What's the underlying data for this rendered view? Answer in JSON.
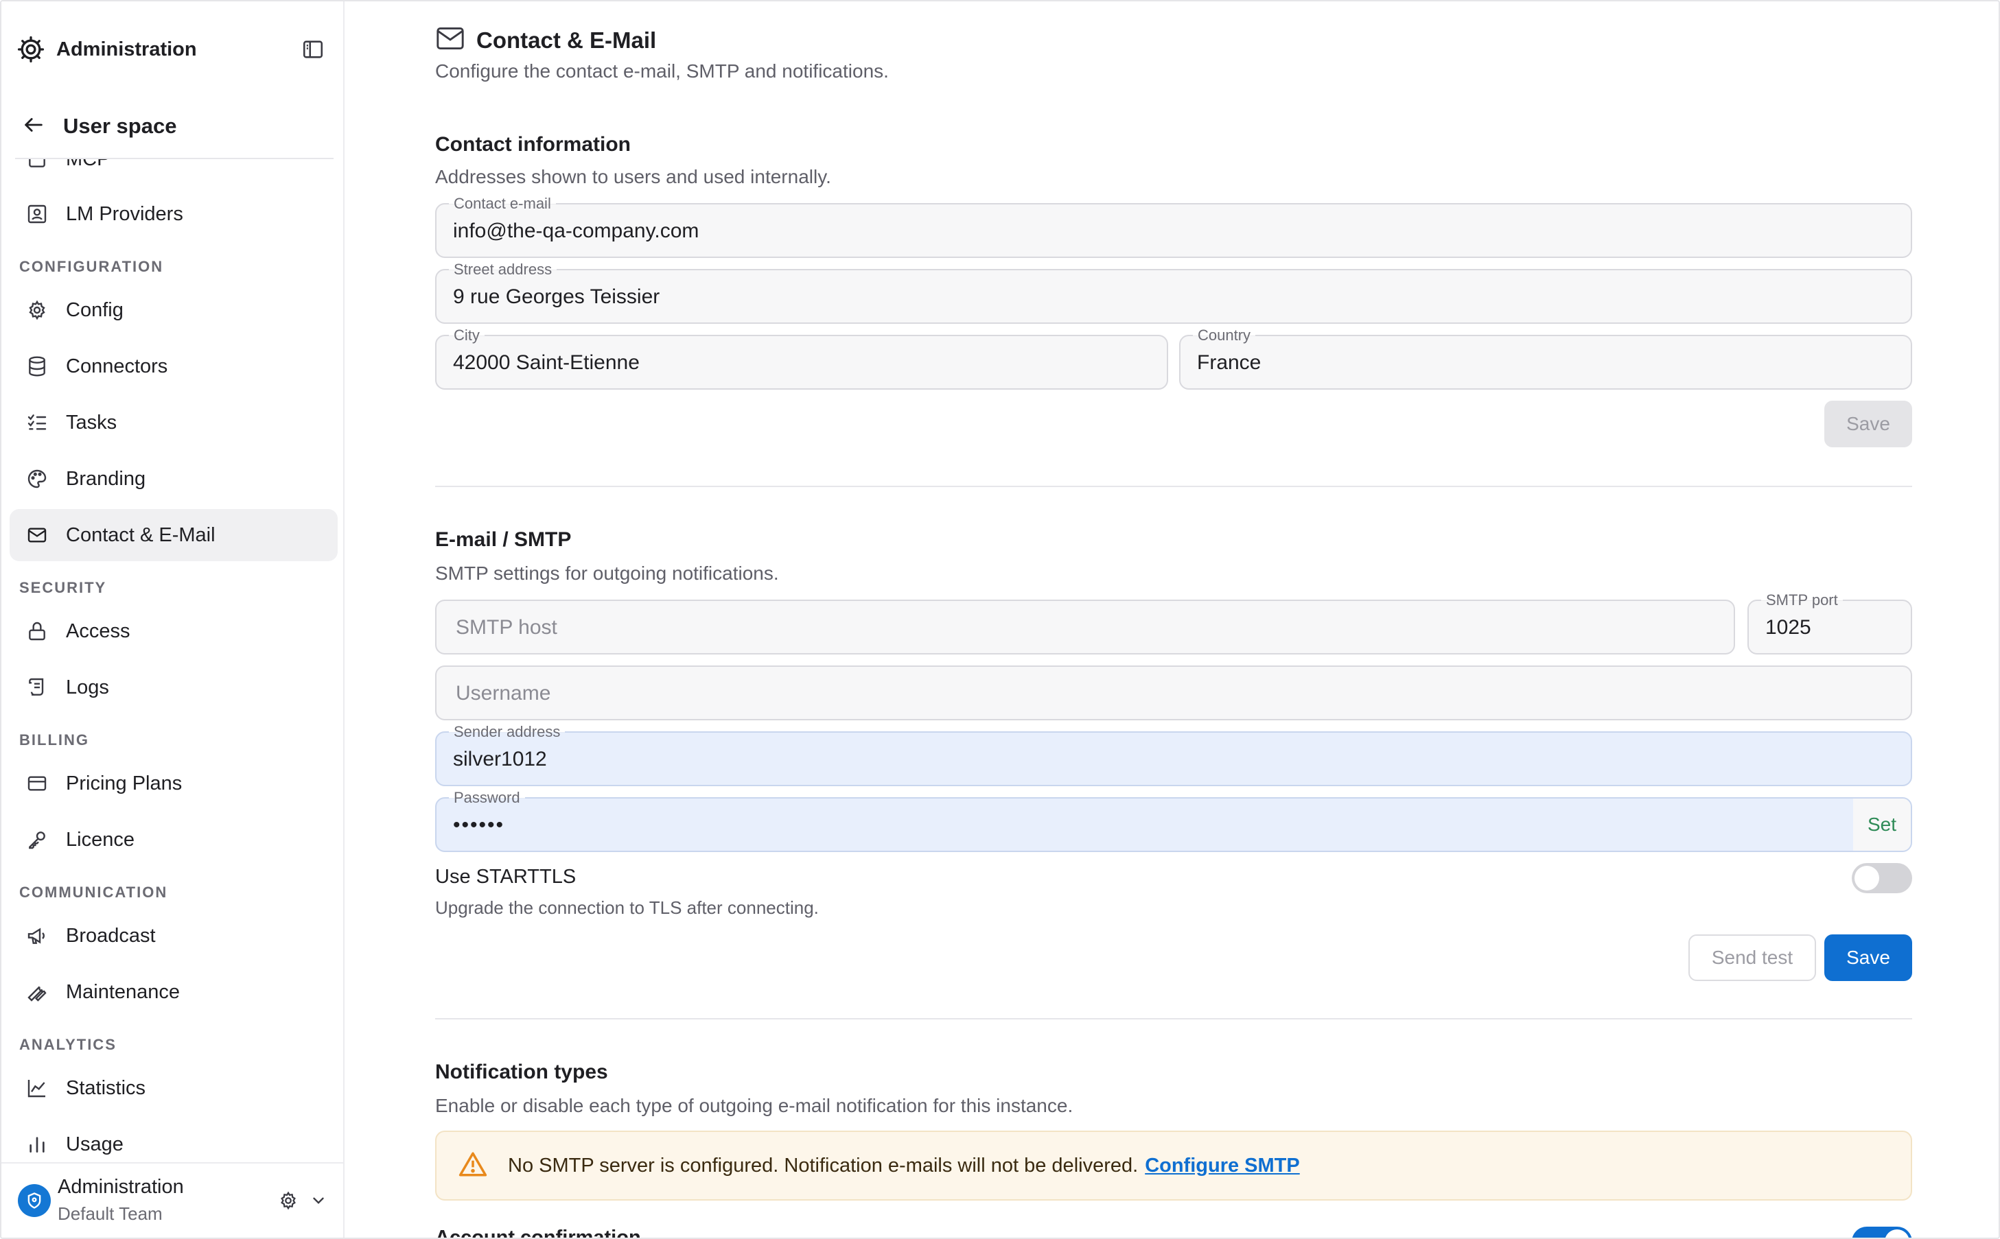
{
  "sidebar": {
    "title": "Administration",
    "back_label": "User space",
    "cut_item": "MCP",
    "items": [
      {
        "label": "LM Providers",
        "icon": "lm-providers-icon"
      },
      {
        "label": "Config",
        "icon": "gear-icon"
      },
      {
        "label": "Connectors",
        "icon": "database-icon"
      },
      {
        "label": "Tasks",
        "icon": "checklist-icon"
      },
      {
        "label": "Branding",
        "icon": "palette-icon"
      },
      {
        "label": "Contact & E-Mail",
        "icon": "mail-icon",
        "active": true
      },
      {
        "label": "Access",
        "icon": "lock-icon"
      },
      {
        "label": "Logs",
        "icon": "scroll-icon"
      },
      {
        "label": "Pricing Plans",
        "icon": "credit-card-icon"
      },
      {
        "label": "Licence",
        "icon": "key-icon"
      },
      {
        "label": "Broadcast",
        "icon": "megaphone-icon"
      },
      {
        "label": "Maintenance",
        "icon": "wrench-icon"
      },
      {
        "label": "Statistics",
        "icon": "line-chart-icon"
      },
      {
        "label": "Usage",
        "icon": "bar-chart-icon"
      }
    ],
    "sections": {
      "configuration": "CONFIGURATION",
      "security": "SECURITY",
      "billing": "BILLING",
      "communication": "COMMUNICATION",
      "analytics": "ANALYTICS"
    },
    "footer": {
      "name": "Administration",
      "team": "Default Team"
    }
  },
  "page": {
    "title": "Contact & E-Mail",
    "subtitle": "Configure the contact e-mail, SMTP and notifications."
  },
  "contact": {
    "heading": "Contact information",
    "description": "Addresses shown to users and used internally.",
    "email_label": "Contact e-mail",
    "email_value": "info@the-qa-company.com",
    "street_label": "Street address",
    "street_value": "9 rue Georges Teissier",
    "city_label": "City",
    "city_value": "42000 Saint-Etienne",
    "country_label": "Country",
    "country_value": "France",
    "save_label": "Save"
  },
  "smtp": {
    "heading": "E-mail / SMTP",
    "description": "SMTP settings for outgoing notifications.",
    "host_placeholder": "SMTP host",
    "port_label": "SMTP port",
    "port_value": "1025",
    "username_placeholder": "Username",
    "sender_label": "Sender address",
    "sender_value": "silver1012",
    "password_label": "Password",
    "password_value": "••••••",
    "password_set": "Set",
    "starttls_label": "Use STARTTLS",
    "starttls_desc": "Upgrade the connection to TLS after connecting.",
    "starttls_on": false,
    "send_test_label": "Send test",
    "save_label": "Save"
  },
  "notifications": {
    "heading": "Notification types",
    "description": "Enable or disable each type of outgoing e-mail notification for this instance.",
    "alert_text": "No SMTP server is configured. Notification e-mails will not be delivered.",
    "alert_link": "Configure SMTP",
    "first_item": "Account confirmation",
    "first_item_on": true
  },
  "colors": {
    "accent": "#0f6fd1",
    "warning": "#e8891c",
    "set_green": "#2e8b57"
  }
}
